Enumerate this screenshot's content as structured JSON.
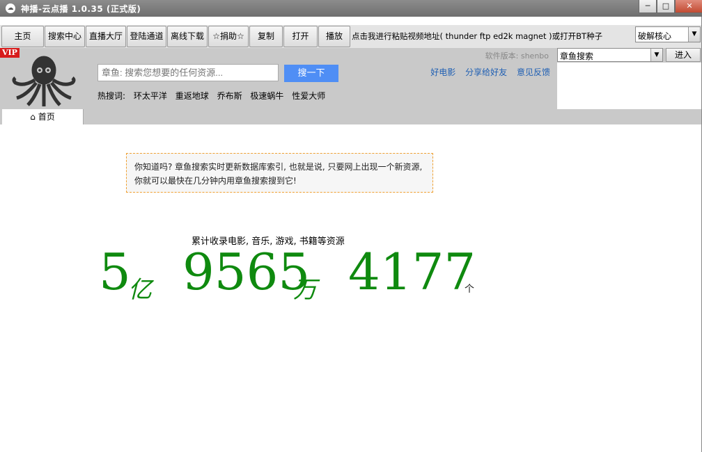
{
  "window": {
    "title": "神播-云点播 1.0.35 (正式版)",
    "controls": [
      "─",
      "□",
      "✕"
    ]
  },
  "toolbar": {
    "buttons": [
      "主页",
      "搜索中心",
      "直播大厅",
      "登陆通道",
      "离线下载",
      "☆捐助☆",
      "复制",
      "打开",
      "播放"
    ],
    "paste_hint": "点击我进行粘贴视频地址( thunder ftp ed2k magnet )或打开BT种子",
    "crack_core": "破解核心"
  },
  "header": {
    "vip_badge": "VIP",
    "search_placeholder": "章鱼: 搜索您想要的任何资源...",
    "search_button": "搜一下",
    "hot_label": "热搜词:",
    "hot_words": [
      "环太平洋",
      "重返地球",
      "乔布斯",
      "极速蜗牛",
      "性爱大师"
    ],
    "version": "软件版本: shenbo",
    "links": [
      "好电影",
      "分享给好友",
      "意见反馈"
    ]
  },
  "right_panel": {
    "engine_select": "章鱼搜索",
    "enter_button": "进入"
  },
  "tabs": [
    {
      "label": "首页",
      "icon": "home-icon"
    }
  ],
  "content": {
    "tip": "你知道吗? 章鱼搜索实时更新数据库索引, 也就是说, 只要网上出现一个新资源, 你就可以最快在几分钟内用章鱼搜索搜到它!",
    "stat_caption": "累计收录电影, 音乐, 游戏, 书籍等资源",
    "stat_yi": "5",
    "unit_yi": "亿",
    "stat_wan": "9565",
    "unit_wan": "万",
    "stat_rest": "4177",
    "unit_ge": "个"
  },
  "colors": {
    "accent_green": "#0f8a0f",
    "search_button_blue": "#4f8ef5",
    "vip_red": "#d71c1c",
    "link_blue": "#1f5fb3"
  }
}
